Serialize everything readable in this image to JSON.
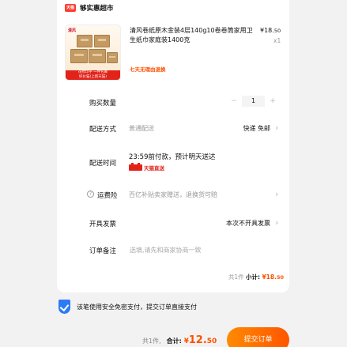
{
  "store": {
    "badge": "天猫",
    "name": "够实惠超市"
  },
  "product": {
    "title": "清风卷纸原木金装4层140g10卷卷筒家用卫生纸巾家庭装1400克",
    "price_currency": "¥",
    "price_int": "18.",
    "price_dec": "50",
    "quantity_text": "x1",
    "return_tag": "七天无理由退换",
    "thumb_brand": "清风",
    "thumb_tag_line1": "花纹印字 一件包邮",
    "thumb_tag_line2": "好价猫(上新天猫)"
  },
  "rows": {
    "qty_label": "购买数量",
    "qty_minus": "−",
    "qty_value": "1",
    "qty_plus": "+",
    "shipping_label": "配送方式",
    "shipping_type": "普通配送",
    "shipping_value": "快递 免邮",
    "delivery_label": "配送时间",
    "delivery_time": "23:59前付款，预计明天送达",
    "delivery_tmall": "天猫直送",
    "insurance_label": "运费险",
    "insurance_value": "百亿补贴卖家赠送，退换货可赔",
    "invoice_label": "开具发票",
    "invoice_value": "本次不开具发票",
    "note_label": "订单备注",
    "note_placeholder": "选填,请先和商家协商一致"
  },
  "subtotal": {
    "count": "共1件",
    "label": "小计:",
    "currency": "¥",
    "int": "18.",
    "dec": "50"
  },
  "security": {
    "text": "该笔使用安全免密支付，提交订单直接支付"
  },
  "footer": {
    "count": "共1件,",
    "label": "合计:",
    "currency": "¥",
    "int": "12.",
    "dec": "50",
    "submit_label": "提交订单"
  },
  "colors": {
    "accent": "#ff5000",
    "tmall_red": "#e2231a",
    "shield_blue": "#2d7bf4"
  }
}
